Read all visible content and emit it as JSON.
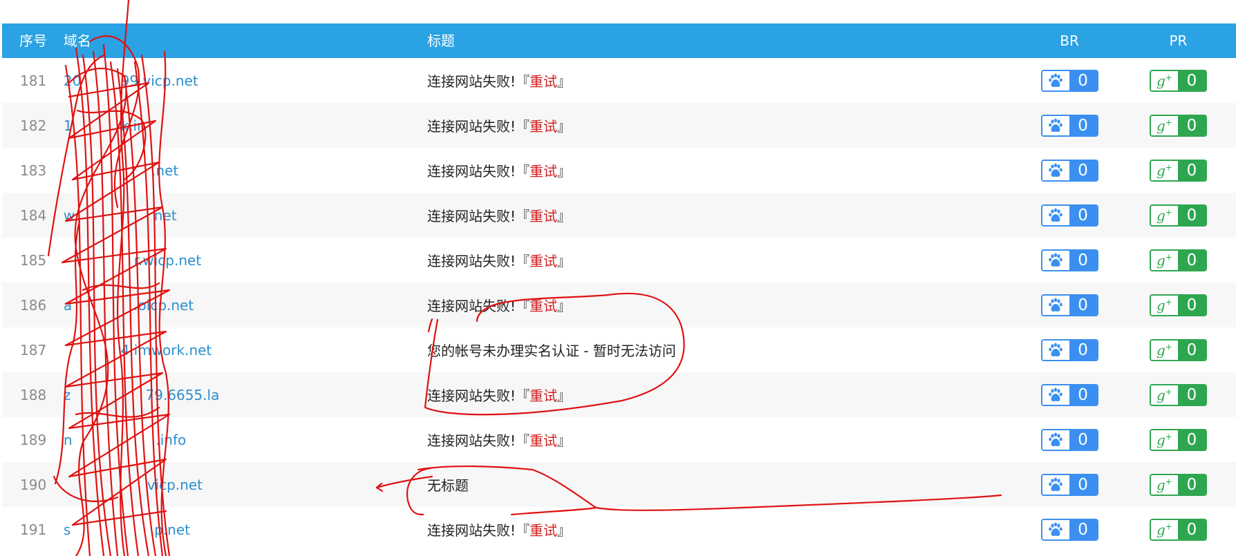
{
  "header": {
    "no": "序号",
    "domain": "域名",
    "title": "标题",
    "br": "BR",
    "pr": "PR"
  },
  "retry_label": "重试",
  "rows": [
    {
      "no": "181",
      "domain_visible": "20         99.vicp.net",
      "title_prefix": "连接网站失败!『",
      "title_retry": true,
      "br": "0",
      "pr": "0"
    },
    {
      "no": "182",
      "domain_visible": "1           k.in",
      "title_prefix": "连接网站失败!『",
      "title_retry": true,
      "br": "0",
      "pr": "0"
    },
    {
      "no": "183",
      "domain_visible": "                    .net",
      "title_prefix": "连接网站失败!『",
      "title_retry": true,
      "br": "0",
      "pr": "0"
    },
    {
      "no": "184",
      "domain_visible": "w                  net",
      "title_prefix": "连接网站失败!『",
      "title_retry": true,
      "br": "0",
      "pr": "0"
    },
    {
      "no": "185",
      "domain_visible": "                r.wicp.net",
      "title_prefix": "连接网站失败!『",
      "title_retry": true,
      "br": "0",
      "pr": "0"
    },
    {
      "no": "186",
      "domain_visible": "a              .oicp.net",
      "title_prefix": "连接网站失败!『",
      "title_retry": true,
      "br": "0",
      "pr": "0"
    },
    {
      "no": "187",
      "domain_visible": "             4.imwork.net",
      "title_full": "您的帐号未办理实名认证 - 暂时无法访问",
      "title_retry": false,
      "br": "0",
      "pr": "0"
    },
    {
      "no": "188",
      "domain_visible": "z                 79.6655.la",
      "title_prefix": "连接网站失败!『",
      "title_retry": true,
      "br": "0",
      "pr": "0"
    },
    {
      "no": "189",
      "domain_visible": "n                   .info",
      "title_prefix": "连接网站失败!『",
      "title_retry": true,
      "br": "0",
      "pr": "0"
    },
    {
      "no": "190",
      "domain_visible": "                   vicp.net",
      "title_full": "无标题",
      "title_retry": false,
      "br": "0",
      "pr": "0"
    },
    {
      "no": "191",
      "domain_visible": "s                   p.net",
      "title_prefix": "连接网站失败!『",
      "title_retry": true,
      "br": "0",
      "pr": "0"
    }
  ],
  "colors": {
    "header_bg": "#2aa2e4",
    "link": "#2a8fcf",
    "retry": "#d01f1f",
    "br_badge": "#3b8ff0",
    "pr_badge": "#2ea650",
    "annotation": "#e01010"
  },
  "icons": {
    "br": "baidu-paw-icon",
    "pr": "google-plus-icon"
  }
}
